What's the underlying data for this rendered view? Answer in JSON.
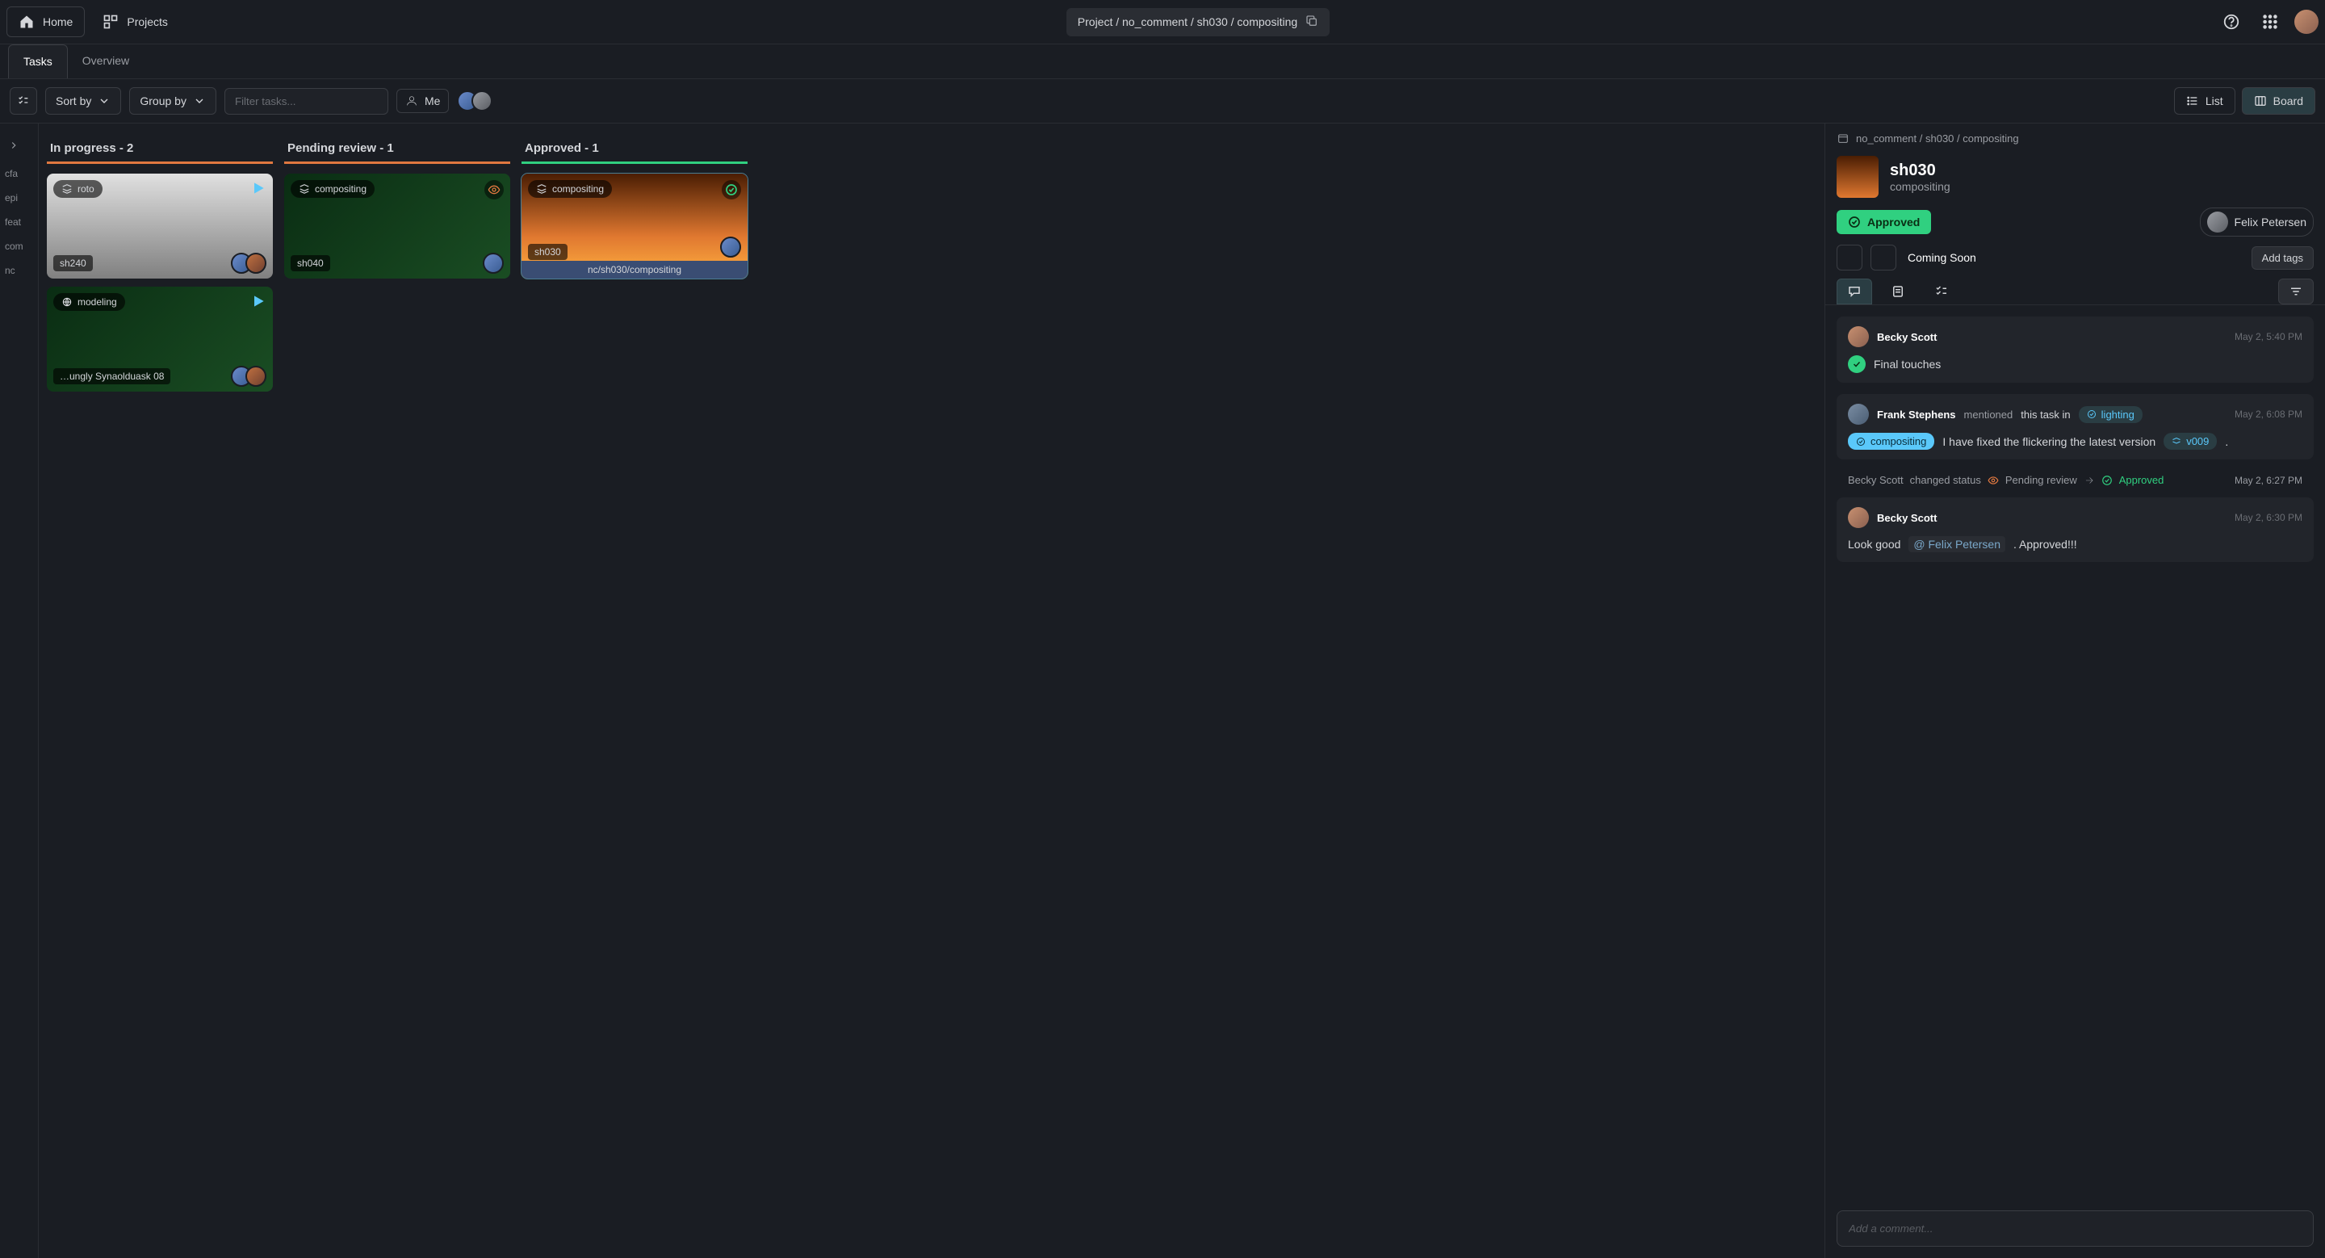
{
  "topbar": {
    "home": "Home",
    "projects": "Projects",
    "breadcrumb": "Project / no_comment / sh030 / compositing"
  },
  "tabs": {
    "tasks": "Tasks",
    "overview": "Overview"
  },
  "toolbar": {
    "sort": "Sort by",
    "group": "Group by",
    "filter_placeholder": "Filter tasks...",
    "me": "Me",
    "list": "List",
    "board": "Board"
  },
  "sidebar": [
    "cfa",
    "epi",
    "feat",
    "com",
    "nc"
  ],
  "columns": [
    {
      "title": "In progress - 2",
      "color": "orange",
      "cards": [
        {
          "tag": "roto",
          "label": "sh240",
          "thumb": "bw",
          "play": true,
          "assignees": 2
        },
        {
          "tag": "modeling",
          "label": "…ungly Synaolduask 08",
          "thumb": "plant",
          "play": true,
          "assignees": 2
        }
      ]
    },
    {
      "title": "Pending review - 1",
      "color": "orange",
      "cards": [
        {
          "tag": "compositing",
          "label": "sh040",
          "thumb": "plant",
          "eye": true,
          "assignees": 1
        }
      ]
    },
    {
      "title": "Approved - 1",
      "color": "green",
      "cards": [
        {
          "tag": "compositing",
          "label": "sh030",
          "sub": "nc/sh030/compositing",
          "thumb": "fire",
          "check": true,
          "assignees": 1,
          "selected": true
        }
      ]
    }
  ],
  "detail": {
    "crumb": "no_comment / sh030 / compositing",
    "title": "sh030",
    "subtitle": "compositing",
    "status": "Approved",
    "assignee": "Felix Petersen",
    "coming_soon": "Coming Soon",
    "add_tags": "Add tags",
    "compose_placeholder": "Add a comment..."
  },
  "activity": [
    {
      "type": "comment",
      "author": "Becky Scott",
      "time": "May 2, 5:40 PM",
      "body_prefix": "",
      "text": "Final touches",
      "check": true
    },
    {
      "type": "mention",
      "author": "Frank Stephens",
      "verb": "mentioned",
      "tail": "this task in",
      "link": "lighting",
      "time": "May 2, 6:08 PM",
      "pill": "compositing",
      "body_text": "I have fixed the flickering the latest version",
      "version": "v009",
      "after": "."
    },
    {
      "type": "status",
      "author": "Becky Scott",
      "verb": "changed status",
      "from": "Pending review",
      "to": "Approved",
      "time": "May 2, 6:27 PM"
    },
    {
      "type": "comment",
      "author": "Becky Scott",
      "time": "May 2, 6:30 PM",
      "body_prefix": "Look good",
      "mention": "Felix Petersen",
      "suffix": ". Approved!!!"
    }
  ]
}
